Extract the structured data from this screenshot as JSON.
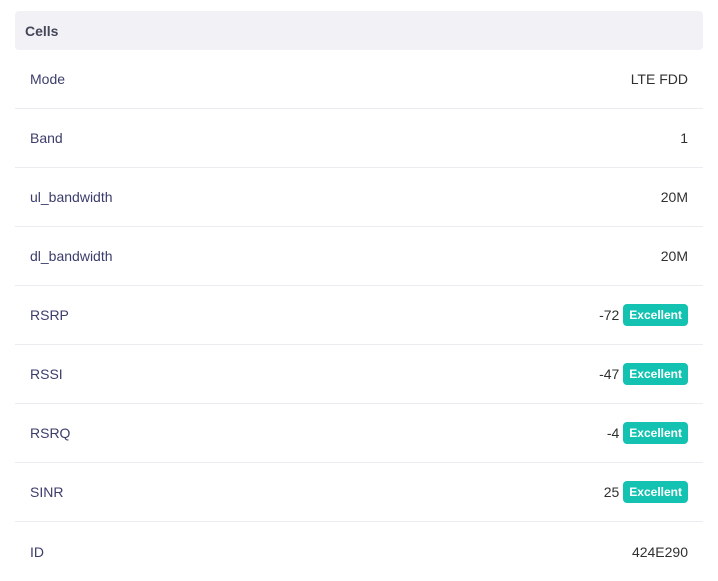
{
  "panel": {
    "title": "Cells",
    "rows": [
      {
        "label": "Mode",
        "value": "LTE FDD"
      },
      {
        "label": "Band",
        "value": "1"
      },
      {
        "label": "ul_bandwidth",
        "value": "20M"
      },
      {
        "label": "dl_bandwidth",
        "value": "20M"
      },
      {
        "label": "RSRP",
        "value": "-72",
        "badge": "Excellent"
      },
      {
        "label": "RSSI",
        "value": "-47",
        "badge": "Excellent"
      },
      {
        "label": "RSRQ",
        "value": "-4",
        "badge": "Excellent"
      },
      {
        "label": "SINR",
        "value": "25",
        "badge": "Excellent"
      },
      {
        "label": "ID",
        "value": "424E290"
      }
    ]
  },
  "colors": {
    "badge_bg": "#13c2b0",
    "header_bg": "#f2f2f6",
    "label_text": "#3b3d6b"
  }
}
